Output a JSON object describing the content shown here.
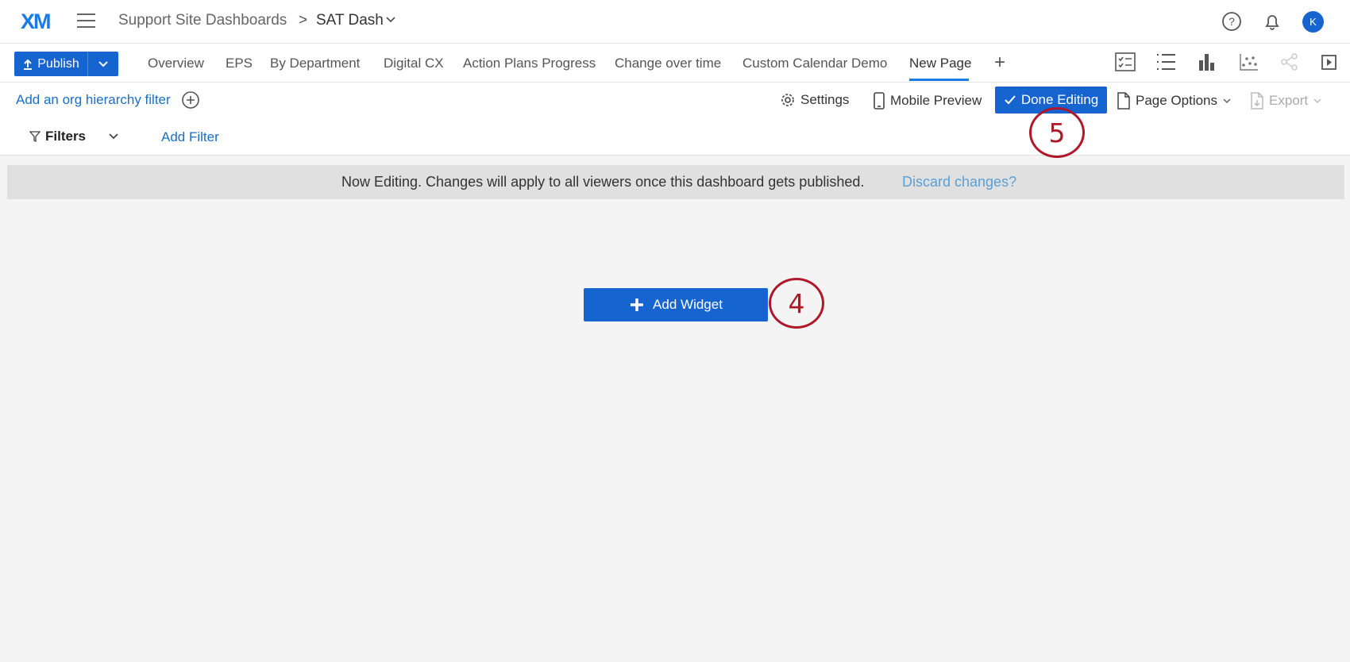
{
  "header": {
    "logo": "XM",
    "breadcrumb_parent": "Support Site Dashboards",
    "breadcrumb_separator": ">",
    "breadcrumb_current": "SAT Dash",
    "avatar_initial": "K"
  },
  "tabbar": {
    "publish_label": "Publish",
    "tabs": [
      {
        "label": "Overview"
      },
      {
        "label": "EPS"
      },
      {
        "label": "By Department"
      },
      {
        "label": "Digital CX"
      },
      {
        "label": "Action Plans Progress"
      },
      {
        "label": "Change over time"
      },
      {
        "label": "Custom Calendar Demo"
      },
      {
        "label": "New Page"
      }
    ],
    "active_tab": "New Page",
    "add_tab": "+"
  },
  "toolbar": {
    "org_filter_label": "Add an org hierarchy filter",
    "settings_label": "Settings",
    "mobile_preview_label": "Mobile Preview",
    "done_editing_label": "Done Editing",
    "page_options_label": "Page Options",
    "export_label": "Export",
    "filters_label": "Filters",
    "add_filter_label": "Add Filter"
  },
  "banner": {
    "message": "Now Editing. Changes will apply to all viewers once this dashboard gets published.",
    "discard_label": "Discard changes?"
  },
  "main": {
    "add_widget_label": "Add Widget"
  },
  "callouts": {
    "step_4": "4",
    "step_5": "5"
  },
  "colors": {
    "primary": "#1664d0",
    "link": "#1a6fc6",
    "callout": "#b0182a",
    "background": "#f4f4f4"
  }
}
